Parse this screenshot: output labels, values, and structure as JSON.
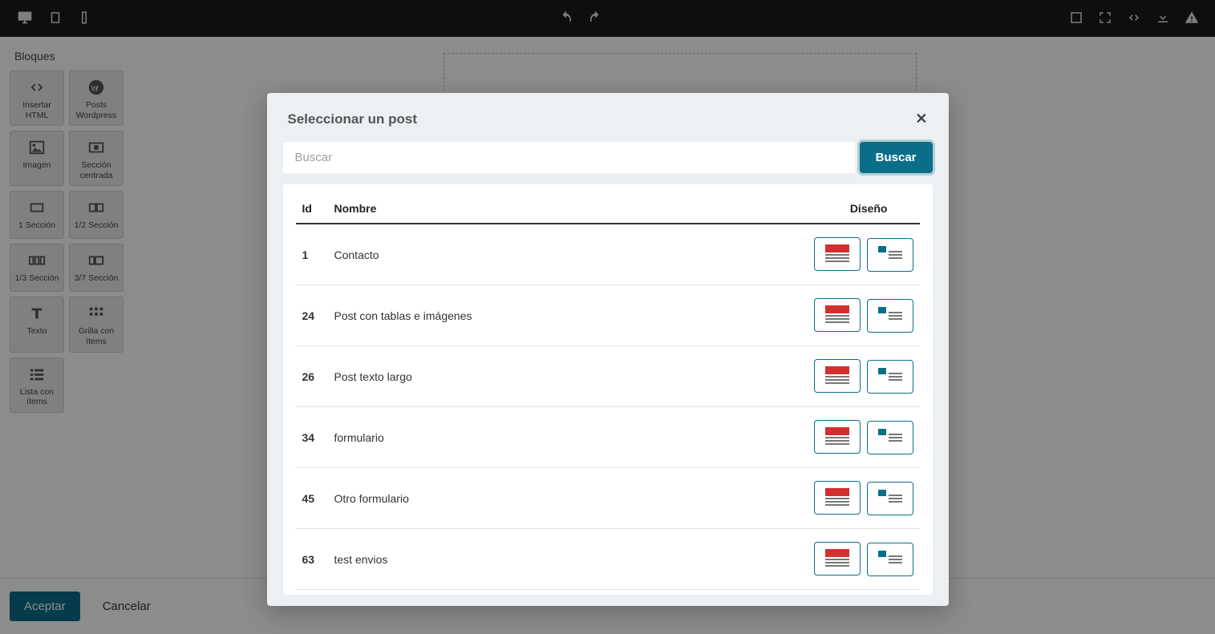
{
  "sidebar": {
    "title": "Bloques",
    "blocks": [
      {
        "label": "Insertar HTML",
        "icon": "code"
      },
      {
        "label": "Posts Wordpress",
        "icon": "wordpress"
      },
      {
        "label": "Imagen",
        "icon": "image"
      },
      {
        "label": "Sección centrada",
        "icon": "section-center"
      },
      {
        "label": "1 Sección",
        "icon": "col1"
      },
      {
        "label": "1/2 Sección",
        "icon": "col2"
      },
      {
        "label": "1/3 Sección",
        "icon": "col3"
      },
      {
        "label": "3/7 Sección",
        "icon": "col37"
      },
      {
        "label": "Texto",
        "icon": "text"
      },
      {
        "label": "Grilla con ítems",
        "icon": "grid"
      },
      {
        "label": "Lista con ítems",
        "icon": "list"
      }
    ]
  },
  "footer": {
    "accept": "Aceptar",
    "cancel": "Cancelar"
  },
  "modal": {
    "title": "Seleccionar un post",
    "search_placeholder": "Buscar",
    "search_button": "Buscar",
    "columns": {
      "id": "Id",
      "name": "Nombre",
      "design": "Diseño"
    },
    "rows": [
      {
        "id": "1",
        "name": "Contacto"
      },
      {
        "id": "24",
        "name": "Post con tablas e imágenes"
      },
      {
        "id": "26",
        "name": "Post texto largo"
      },
      {
        "id": "34",
        "name": "formulario"
      },
      {
        "id": "45",
        "name": "Otro formulario"
      },
      {
        "id": "63",
        "name": "test envios"
      }
    ]
  }
}
